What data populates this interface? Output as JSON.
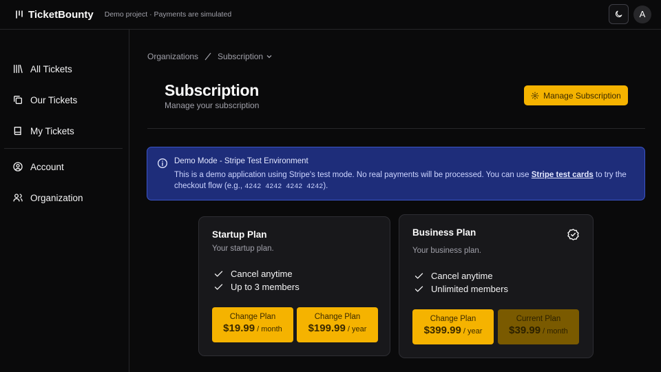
{
  "app": {
    "name": "TicketBounty",
    "note": "Demo project · Payments are simulated",
    "avatar_initial": "A"
  },
  "sidebar": {
    "items": [
      {
        "label": "All Tickets",
        "icon": "library-icon"
      },
      {
        "label": "Our Tickets",
        "icon": "copy-icon"
      },
      {
        "label": "My Tickets",
        "icon": "book-icon"
      },
      {
        "label": "Account",
        "icon": "user-circle-icon"
      },
      {
        "label": "Organization",
        "icon": "users-icon"
      }
    ]
  },
  "breadcrumb": {
    "first": "Organizations",
    "current": "Subscription"
  },
  "page": {
    "title": "Subscription",
    "subtitle": "Manage your subscription",
    "manage_label": "Manage Subscription"
  },
  "alert": {
    "title": "Demo Mode - Stripe Test Environment",
    "body_pre": "This is a demo application using Stripe's test mode. No real payments will be processed. You can use ",
    "link": "Stripe test cards",
    "body_mid": " to try the checkout flow (e.g., ",
    "card_number": "4242 4242 4242 4242",
    "body_post": ")."
  },
  "plans": [
    {
      "name": "Startup Plan",
      "desc": "Your startup plan.",
      "features": [
        "Cancel anytime",
        "Up to 3 members"
      ],
      "prices": [
        {
          "label": "Change Plan",
          "amount": "$19.99",
          "period": " / month"
        },
        {
          "label": "Change Plan",
          "amount": "$199.99",
          "period": " / year"
        }
      ]
    },
    {
      "name": "Business Plan",
      "desc": "Your business plan.",
      "features": [
        "Cancel anytime",
        "Unlimited members"
      ],
      "prices": [
        {
          "label": "Change Plan",
          "amount": "$399.99",
          "period": " / year"
        },
        {
          "label": "Current Plan",
          "amount": "$39.99",
          "period": " / month"
        }
      ]
    }
  ],
  "colors": {
    "accent": "#f5b300",
    "alert_bg": "#1e2d7a",
    "background": "#0a0a0b"
  }
}
